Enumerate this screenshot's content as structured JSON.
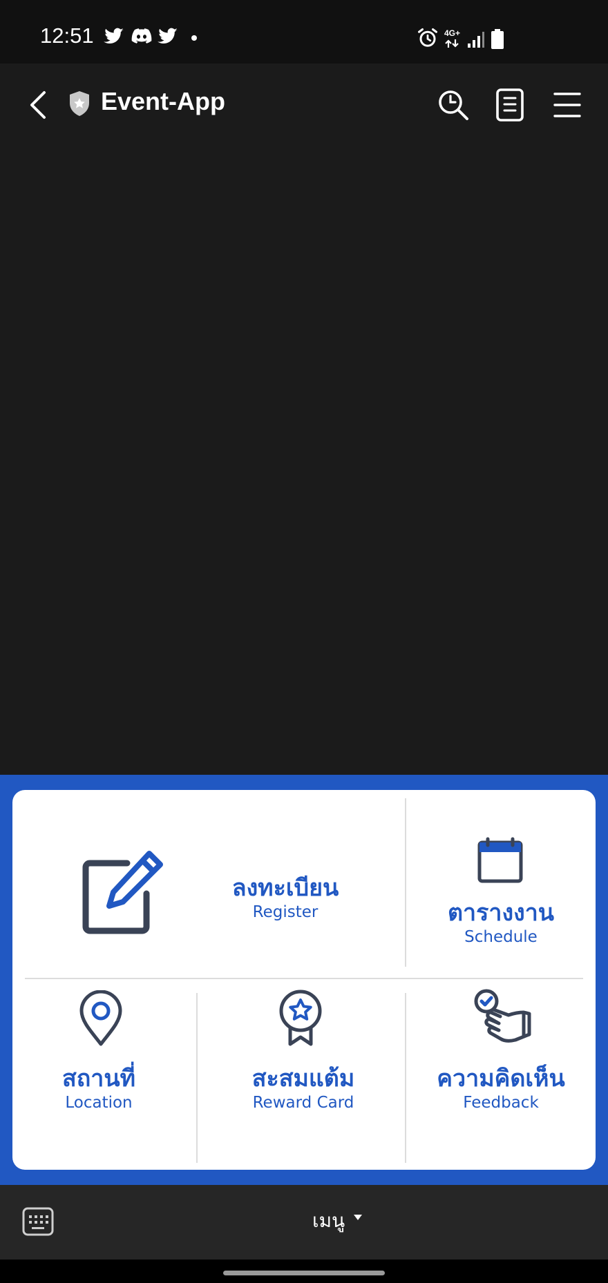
{
  "status_bar": {
    "time": "12:51",
    "left_icons": [
      "twitter-icon",
      "discord-icon",
      "twitter-icon",
      "dot-icon"
    ],
    "right_icons": [
      "alarm-icon",
      "4g-icon",
      "signal-icon",
      "battery-icon"
    ],
    "network": "4G+"
  },
  "app_bar": {
    "title": "Event-App",
    "icons": [
      "back-arrow-icon",
      "shield-icon",
      "search-icon",
      "document-icon",
      "hamburger-icon"
    ]
  },
  "rich_menu": {
    "register": {
      "label_th": "ลงทะเบียน",
      "label_en": "Register",
      "icon": "edit-icon"
    },
    "schedule": {
      "label_th": "ตารางงาน",
      "label_en": "Schedule",
      "icon": "calendar-icon"
    },
    "location": {
      "label_th": "สถานที่",
      "label_en": "Location",
      "icon": "map-pin-icon"
    },
    "reward": {
      "label_th": "สะสมแต้ม",
      "label_en": "Reward Card",
      "icon": "award-star-icon"
    },
    "feedback": {
      "label_th": "ความคิดเห็น",
      "label_en": "Feedback",
      "icon": "hand-check-icon"
    }
  },
  "bottom_bar": {
    "menu_label": "เมนู",
    "icons": [
      "keyboard-icon",
      "caret-down-icon"
    ]
  },
  "colors": {
    "accent": "#2158c2",
    "icon_dark": "#3a4356",
    "background": "#1b1b1b"
  }
}
